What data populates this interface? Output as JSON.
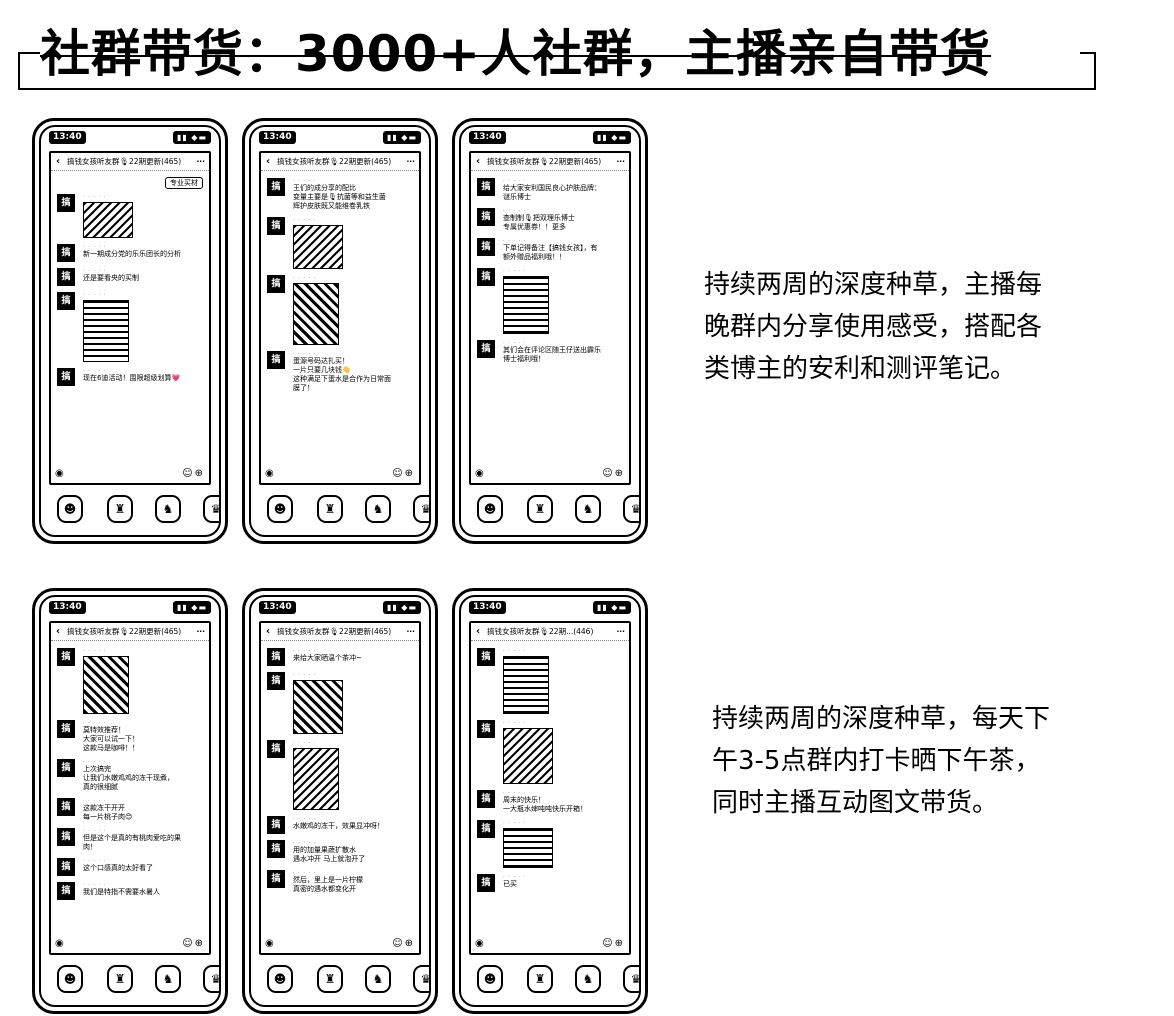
{
  "title": "社群带货：3000+人社群，主播亲自带货",
  "captions": [
    "持续两周的深度种草，主播每\n晚群内分享使用感受，搭配各\n类博主的安利和测评笔记。",
    "持续两周的深度种草，每天下\n午3-5点群内打卡晒下午茶，\n同时主播互动图文带货。"
  ],
  "phones": [
    {
      "time": "13:40",
      "group": "搞钱女孩听友群🎙22期更新(465)",
      "messages": [
        {
          "type": "right",
          "text": "专业买材"
        },
        {
          "type": "img",
          "h": 36,
          "style": "soft"
        },
        {
          "type": "text",
          "text": "新一期成分党的乐乐团长的分析"
        },
        {
          "type": "text",
          "text": "还是要看央的买制"
        },
        {
          "type": "img",
          "h": 62,
          "style": "list"
        },
        {
          "type": "text",
          "text": "现在6迪活动！围限超级划算💗"
        }
      ]
    },
    {
      "time": "13:40",
      "group": "搞钱女孩听友群🎙22期更新(465)",
      "messages": [
        {
          "type": "text",
          "text": "王们的成分享的配比\n变量主要是🎙抗菌等和益生菌\n辉护皮肤既又能维卷乳铁"
        },
        {
          "type": "img",
          "h": 44,
          "style": "soft"
        },
        {
          "type": "img",
          "h": 62,
          "style": "normal"
        },
        {
          "type": "text",
          "text": "蛋源号码达扎买！\n一片只要几块钱👋\n这种满足下蛋水是合作为日常面\n膜了！"
        }
      ]
    },
    {
      "time": "13:40",
      "group": "搞钱女孩听友群🎙22期更新(465)",
      "messages": [
        {
          "type": "text",
          "text": "给大家安利国民良心护肤品牌：\n谜乐博士"
        },
        {
          "type": "text",
          "text": "查制制🎙把双理乐博士\n专属优惠券！！更多"
        },
        {
          "type": "text",
          "text": "下单记得备注【搞钱女孩】，有\n额外赠品福利哦！！"
        },
        {
          "type": "img",
          "h": 58,
          "style": "list"
        },
        {
          "type": "text",
          "text": "其们会在评论区随王仔送出霹乐\n博士福利哦！"
        }
      ]
    },
    {
      "time": "13:40",
      "group": "搞钱女孩听友群🎙22期更新(465)",
      "messages": [
        {
          "type": "img",
          "h": 58,
          "style": "normal"
        },
        {
          "type": "text",
          "text": "莫特效推荐！\n大家可以试一下！\n这款马是咖啡！！"
        },
        {
          "type": "text",
          "text": "上次搞完\n让我们水嫩鸡鸡的冻干现煮，\n真的很细腻"
        },
        {
          "type": "text",
          "text": "这款冻干开开\n每一片桃子肉😊"
        },
        {
          "type": "text",
          "text": "但是这个是真的有桃肉爱吃的果\n肉！"
        },
        {
          "type": "text",
          "text": "这个口感真的太好看了"
        },
        {
          "type": "text",
          "text": "我们是特指不需要水暑人"
        }
      ]
    },
    {
      "time": "13:40",
      "group": "搞钱女孩听友群🎙22期更新(465)",
      "messages": [
        {
          "type": "text",
          "text": "来给大家晒温个茶冲~"
        },
        {
          "type": "img",
          "h": 54,
          "style": "normal"
        },
        {
          "type": "img",
          "h": 62,
          "style": "soft"
        },
        {
          "type": "text",
          "text": "水嫩鸡的冻干，效果显冲呀！"
        },
        {
          "type": "text",
          "text": "用的加量果蔬扩散水\n遇水冲开 马上就泡开了"
        },
        {
          "type": "text",
          "text": "然后，里上是一片柠檬\n真密的遇水都变化开"
        }
      ]
    },
    {
      "time": "13:40",
      "group": "搞钱女孩听友群🎙22期...(446)",
      "messages": [
        {
          "type": "img",
          "h": 58,
          "style": "list"
        },
        {
          "type": "img",
          "h": 56,
          "style": "soft"
        },
        {
          "type": "text",
          "text": "周末的快乐！\n一大瓶水婶吨吨快乐开箱！"
        },
        {
          "type": "img",
          "h": 40,
          "style": "list"
        },
        {
          "type": "text",
          "text": "已买"
        }
      ]
    }
  ],
  "icons": {
    "back": "‹",
    "more": "···",
    "voice": "◉",
    "emoji": "☺⊕",
    "battery": "▮▮ ◆▬",
    "dock": [
      "☻",
      "♜",
      "♞",
      "♛"
    ]
  }
}
